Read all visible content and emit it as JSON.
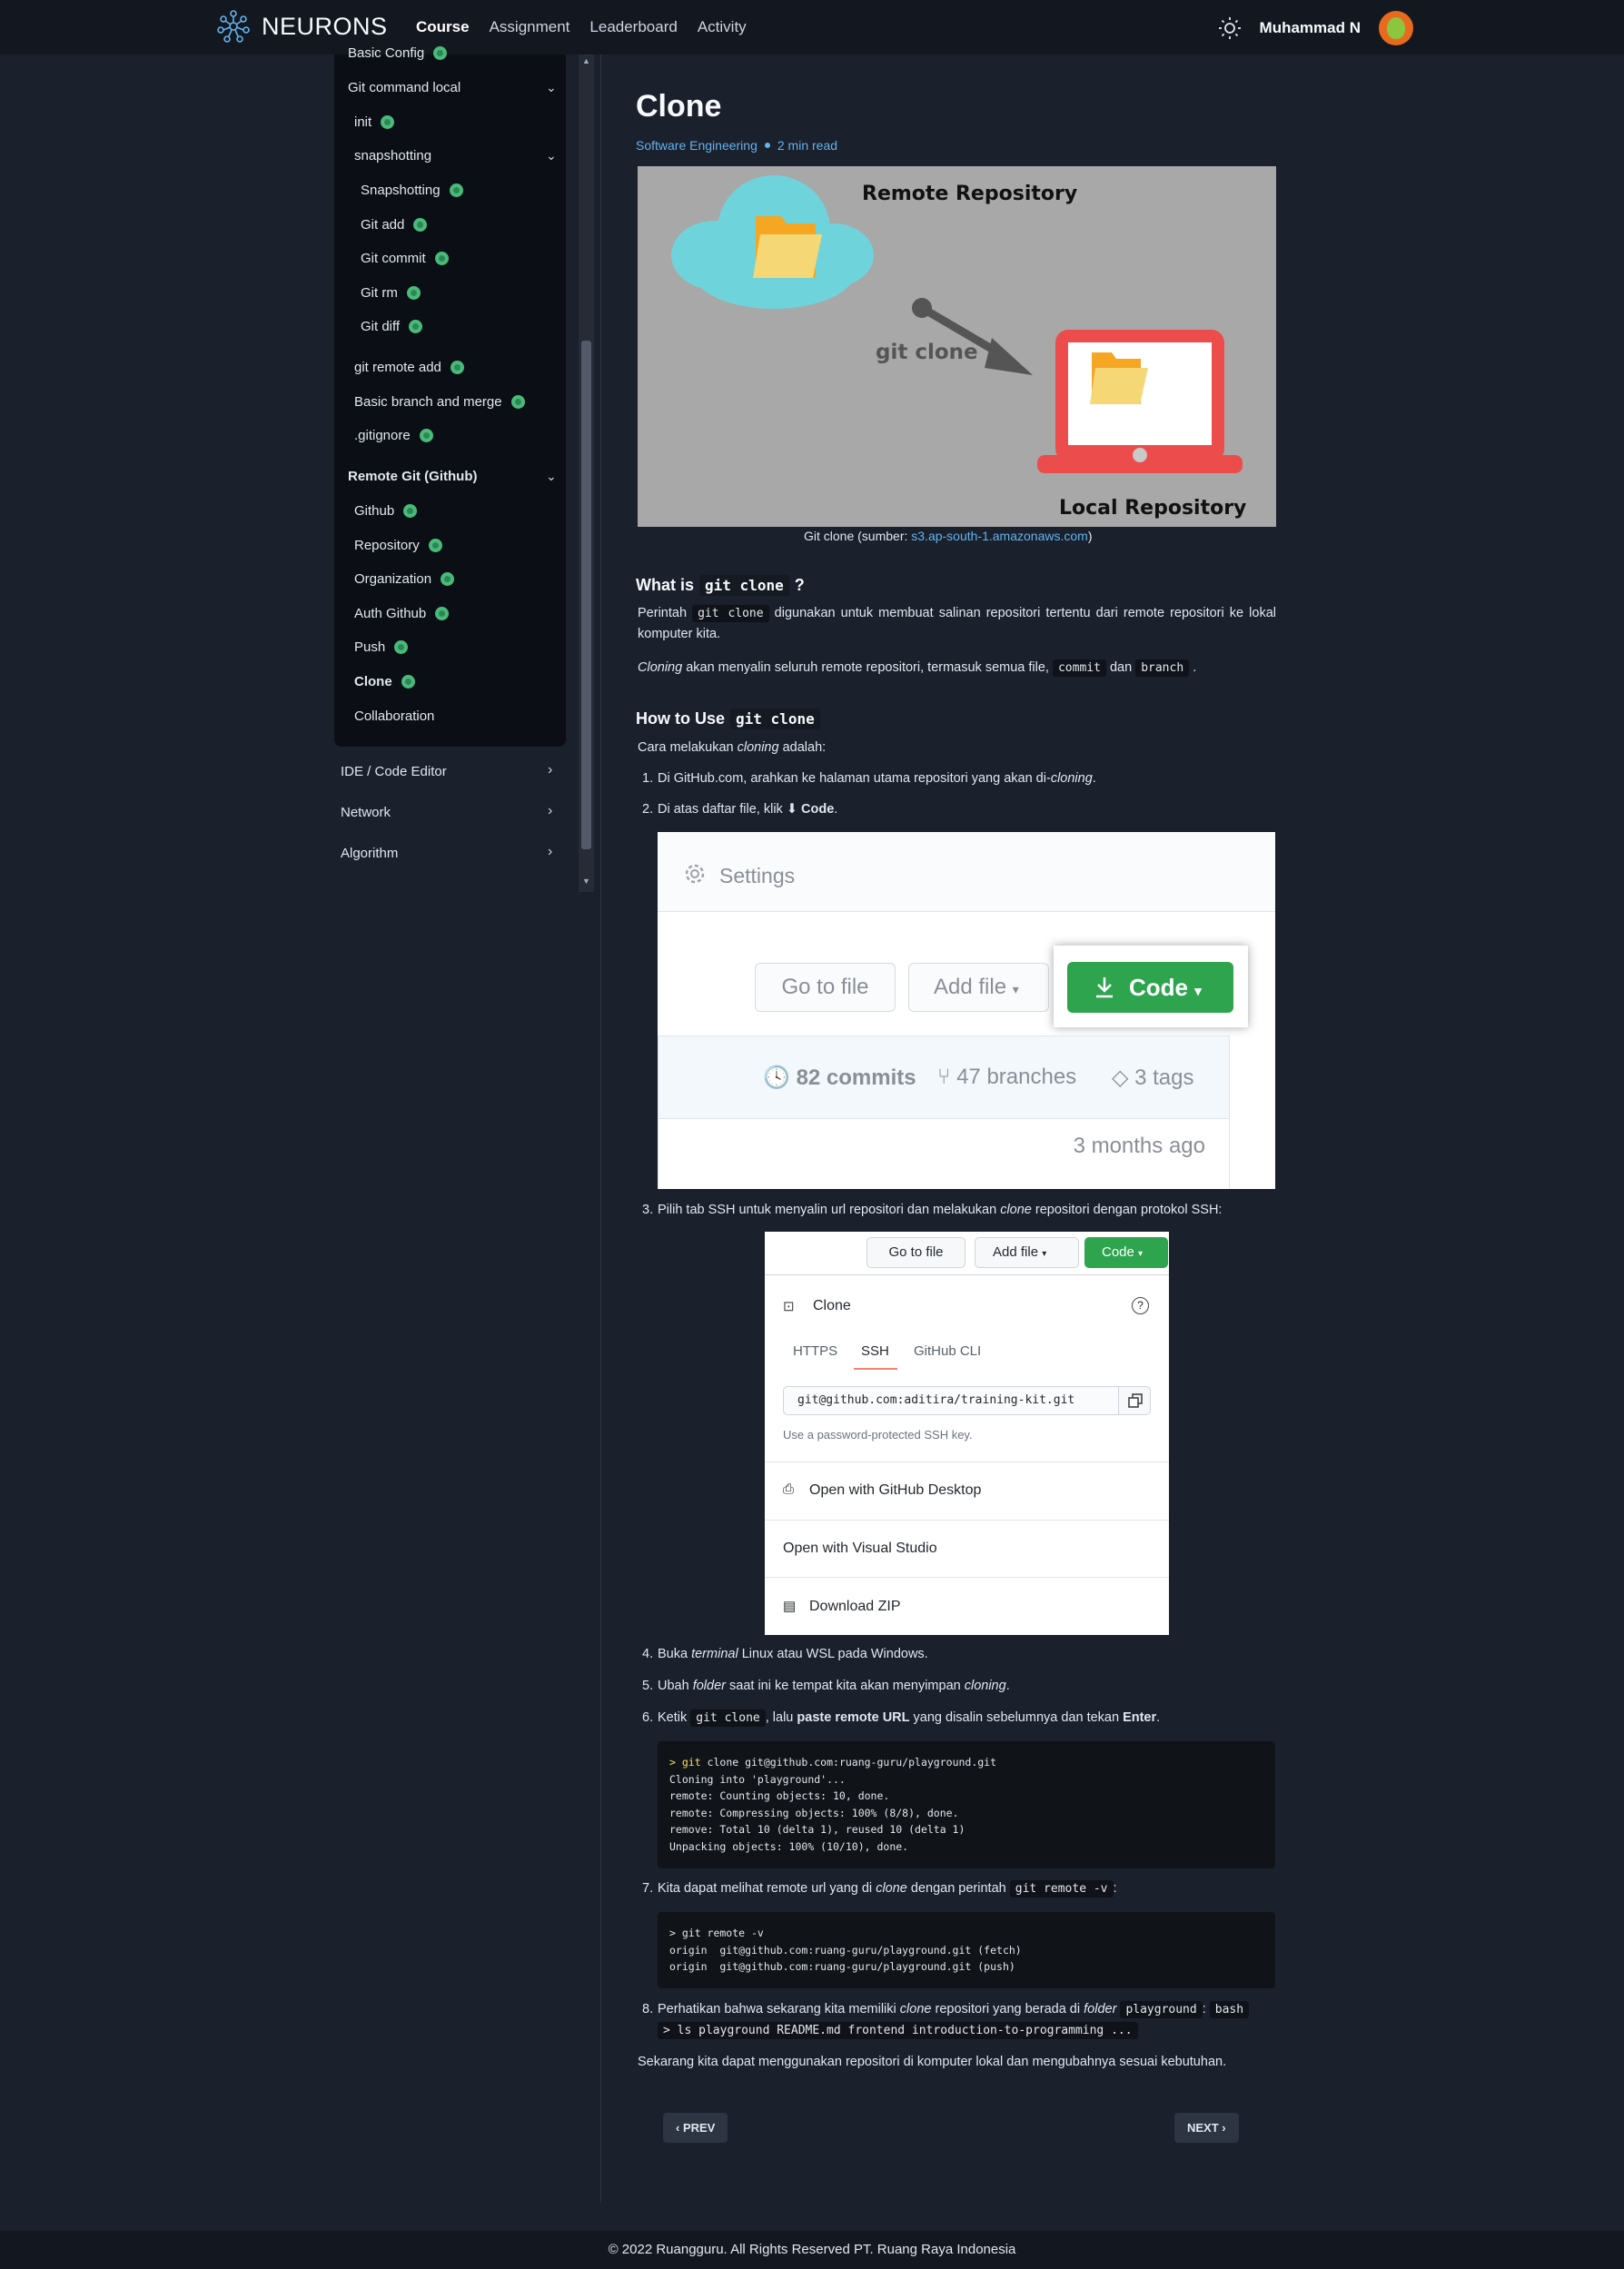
{
  "nav": {
    "brand": "NEURONS",
    "links": [
      "Course",
      "Assignment",
      "Leaderboard",
      "Activity"
    ],
    "user_name": "Muhammad N"
  },
  "sidebar": {
    "items": [
      {
        "label": "Basic Config",
        "check": true
      },
      {
        "label": "Git command local",
        "check": false
      },
      {
        "label": "init",
        "check": true
      },
      {
        "label": "snapshotting",
        "check": false
      },
      {
        "label": "Snapshotting",
        "check": true
      },
      {
        "label": "Git add",
        "check": true
      },
      {
        "label": "Git commit",
        "check": true
      },
      {
        "label": "Git rm",
        "check": true
      },
      {
        "label": "Git diff",
        "check": true
      },
      {
        "label": "git remote add",
        "check": true
      },
      {
        "label": "Basic branch and merge",
        "check": true
      },
      {
        "label": ".gitignore",
        "check": true
      },
      {
        "label": "Remote Git (Github)",
        "check": false
      },
      {
        "label": "Github",
        "check": true
      },
      {
        "label": "Repository",
        "check": true
      },
      {
        "label": "Organization",
        "check": true
      },
      {
        "label": "Auth Github",
        "check": true
      },
      {
        "label": "Push",
        "check": true
      },
      {
        "label": "Clone",
        "check": true
      },
      {
        "label": "Collaboration",
        "check": false
      }
    ],
    "outer": [
      "IDE / Code Editor",
      "Network",
      "Algorithm"
    ]
  },
  "article": {
    "title": "Clone",
    "category": "Software Engineering",
    "read_time": "2 min read",
    "figure1": {
      "remote_label": "Remote Repository",
      "arrow_label": "git clone",
      "local_label": "Local Repository",
      "caption_prefix": "Git clone (sumber: ",
      "caption_link": "s3.ap-south-1.amazonaws.com",
      "caption_suffix": ")"
    },
    "what_heading": "What is",
    "what_code": "git clone",
    "what_q": "?",
    "p1_a": "Perintah",
    "p1_code": "git clone",
    "p1_b": "digunakan untuk membuat salinan repositori tertentu dari remote repositori ke lokal komputer kita.",
    "p2_em": "Cloning",
    "p2_a": "akan menyalin seluruh remote repositori, termasuk semua file,",
    "p2_code1": "commit",
    "p2_mid": "dan",
    "p2_code2": "branch",
    "p2_end": ".",
    "how_heading": "How to Use",
    "how_code": "git clone",
    "how_intro_a": "Cara melakukan",
    "how_intro_em": "cloning",
    "how_intro_b": "adalah:",
    "step1_a": "Di GitHub.com, arahkan ke halaman utama repositori yang akan di-",
    "step1_em": "cloning",
    "step1_b": ".",
    "step2_a": "Di atas daftar file, klik ⬇",
    "step2_b": "Code",
    "step2_c": ".",
    "figure2": {
      "settings": "Settings",
      "go_to_file": "Go to file",
      "add_file": "Add file",
      "code": "Code",
      "commits": "82 commits",
      "branches": "47 branches",
      "tags": "3 tags",
      "time": "3 months ago"
    },
    "step3_a": "Pilih tab SSH untuk menyalin url repositori dan melakukan",
    "step3_em": "clone",
    "step3_b": "repositori dengan protokol SSH:",
    "figure3": {
      "go_to_file": "Go to file",
      "add_file": "Add file",
      "code": "Code",
      "clone": "Clone",
      "tabs": [
        "HTTPS",
        "SSH",
        "GitHub CLI"
      ],
      "url": "git@github.com:aditira/training-kit.git",
      "hint": "Use a password-protected SSH key.",
      "open_desktop": "Open with GitHub Desktop",
      "open_vs": "Open with Visual Studio",
      "download_zip": "Download ZIP"
    },
    "step4_a": "Buka",
    "step4_em": "terminal",
    "step4_b": "Linux atau WSL pada Windows.",
    "step5_a": "Ubah",
    "step5_em": "folder",
    "step5_b": "saat ini ke tempat kita akan menyimpan",
    "step5_em2": "cloning",
    "step5_c": ".",
    "step6_a": "Ketik",
    "step6_code": "git clone",
    "step6_b": ", lalu",
    "step6_strong": "paste remote URL",
    "step6_c": "yang disalin sebelumnya dan tekan",
    "step6_strong2": "Enter",
    "step6_d": ".",
    "code1": [
      "> git clone git@github.com:ruang-guru/playground.git",
      "Cloning into 'playground'...",
      "remote: Counting objects: 10, done.",
      "remote: Compressing objects: 100% (8/8), done.",
      "remove: Total 10 (delta 1), reused 10 (delta 1)",
      "Unpacking objects: 100% (10/10), done."
    ],
    "step7_a": "Kita dapat melihat remote url yang di",
    "step7_em": "clone",
    "step7_b": "dengan perintah",
    "step7_code": "git remote -v",
    "step7_c": ":",
    "code2": [
      "> git remote -v",
      "origin  git@github.com:ruang-guru/playground.git (fetch)",
      "origin  git@github.com:ruang-guru/playground.git (push)"
    ],
    "step8_a": "Perhatikan bahwa sekarang kita memiliki",
    "step8_em": "clone",
    "step8_b": "repositori yang berada di",
    "step8_em2": "folder",
    "step8_code1": "playground",
    "step8_c": ":",
    "step8_code2": "bash",
    "step8_code3": "> ls playground README.md frontend introduction-to-programming ...",
    "closing": "Sekarang kita dapat menggunakan repositori di komputer lokal dan mengubahnya sesuai kebutuhan.",
    "prev": "PREV",
    "next": "NEXT"
  },
  "footer": "© 2022 Ruangguru. All Rights Reserved PT. Ruang Raya Indonesia"
}
